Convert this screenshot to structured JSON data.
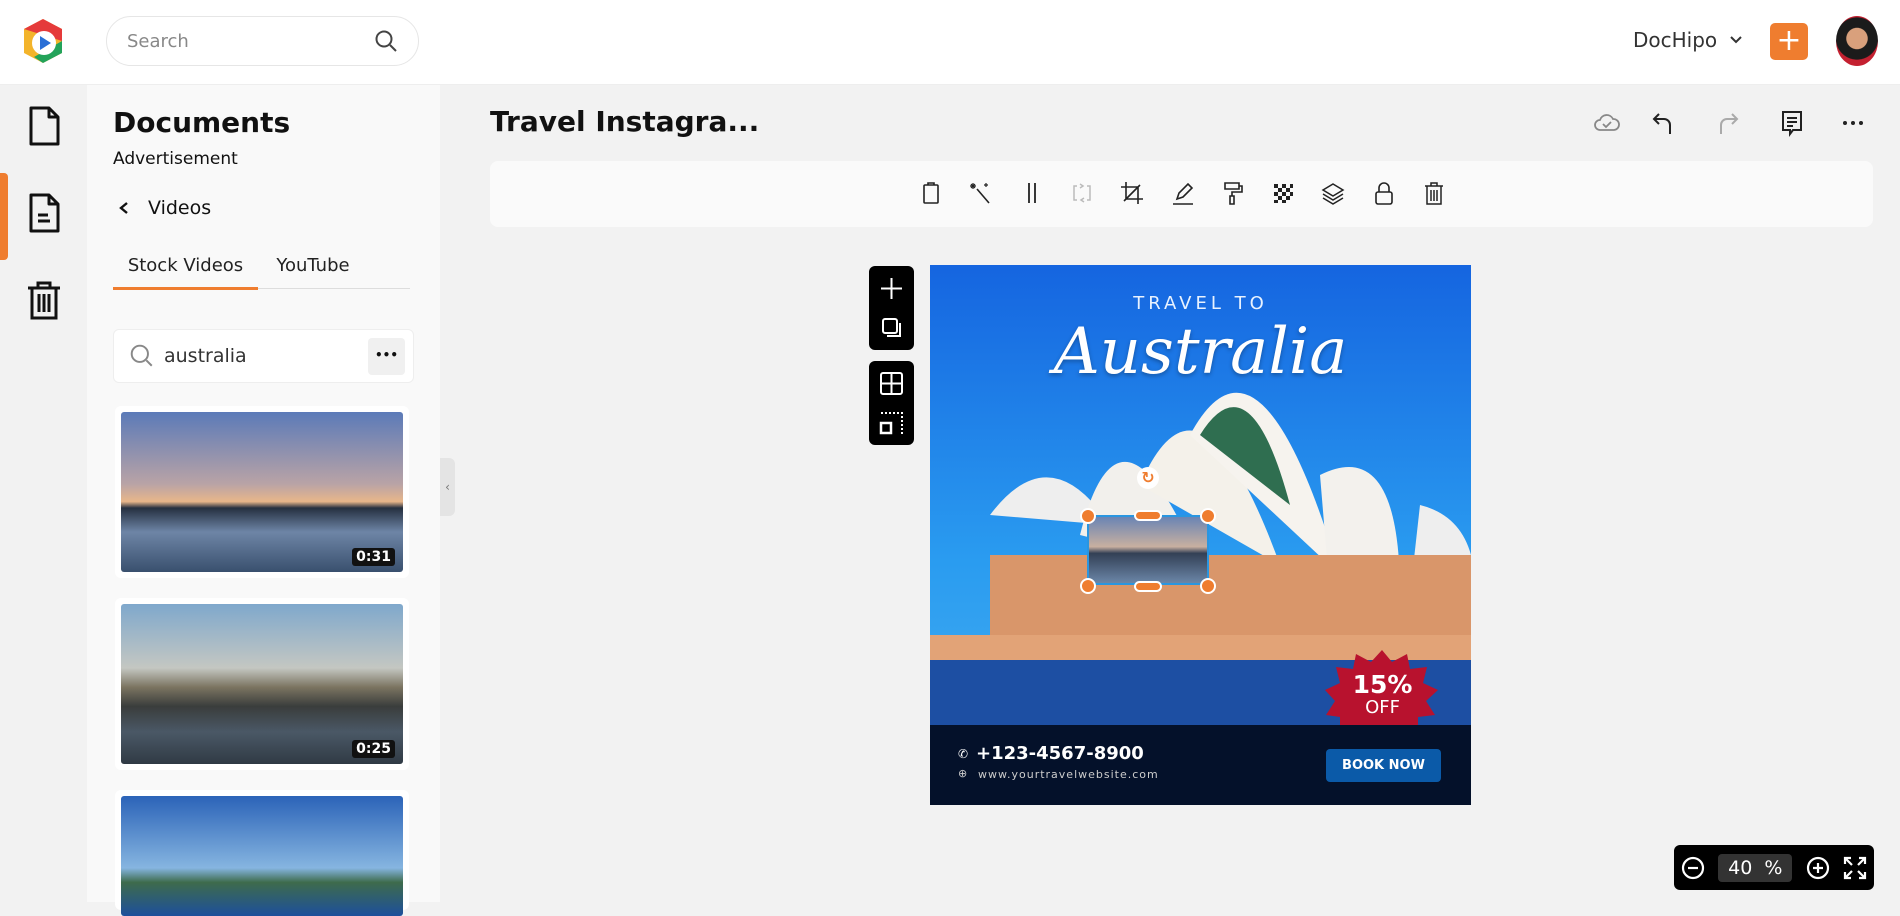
{
  "header": {
    "search_placeholder": "Search",
    "workspace": "DocHipo",
    "add_label": "+"
  },
  "panel": {
    "title": "Documents",
    "subtitle": "Advertisement",
    "back_label": "Videos",
    "tabs": [
      {
        "label": "Stock Videos",
        "active": true
      },
      {
        "label": "YouTube",
        "active": false
      }
    ],
    "search_value": "australia",
    "more_label": "•••",
    "videos": [
      {
        "duration": "0:31"
      },
      {
        "duration": "0:25"
      },
      {
        "duration": ""
      }
    ]
  },
  "editor": {
    "doc_title": "Travel Instagra...",
    "top_actions": [
      "cloud-saved-icon",
      "undo-icon",
      "redo-icon",
      "comment-icon",
      "more-icon"
    ],
    "toolbar": [
      "paste-icon",
      "magic-wand-icon",
      "spacing-icon",
      "replace-icon",
      "crop-icon",
      "edit-icon",
      "paint-roller-icon",
      "transparency-icon",
      "layers-icon",
      "lock-icon",
      "trash-icon"
    ]
  },
  "poster": {
    "kicker": "TRAVEL TO",
    "headline": "Australia",
    "badge_pct": "15%",
    "badge_off": "OFF",
    "phone": "+123-4567-8900",
    "website": "www.yourtravelwebsite.com",
    "cta": "BOOK NOW"
  },
  "zoom": {
    "value": "40",
    "unit": "%"
  },
  "colors": {
    "accent": "#ef7d2f",
    "cta": "#0b5aa8",
    "badge": "#b8122e",
    "footer": "#04112a"
  }
}
